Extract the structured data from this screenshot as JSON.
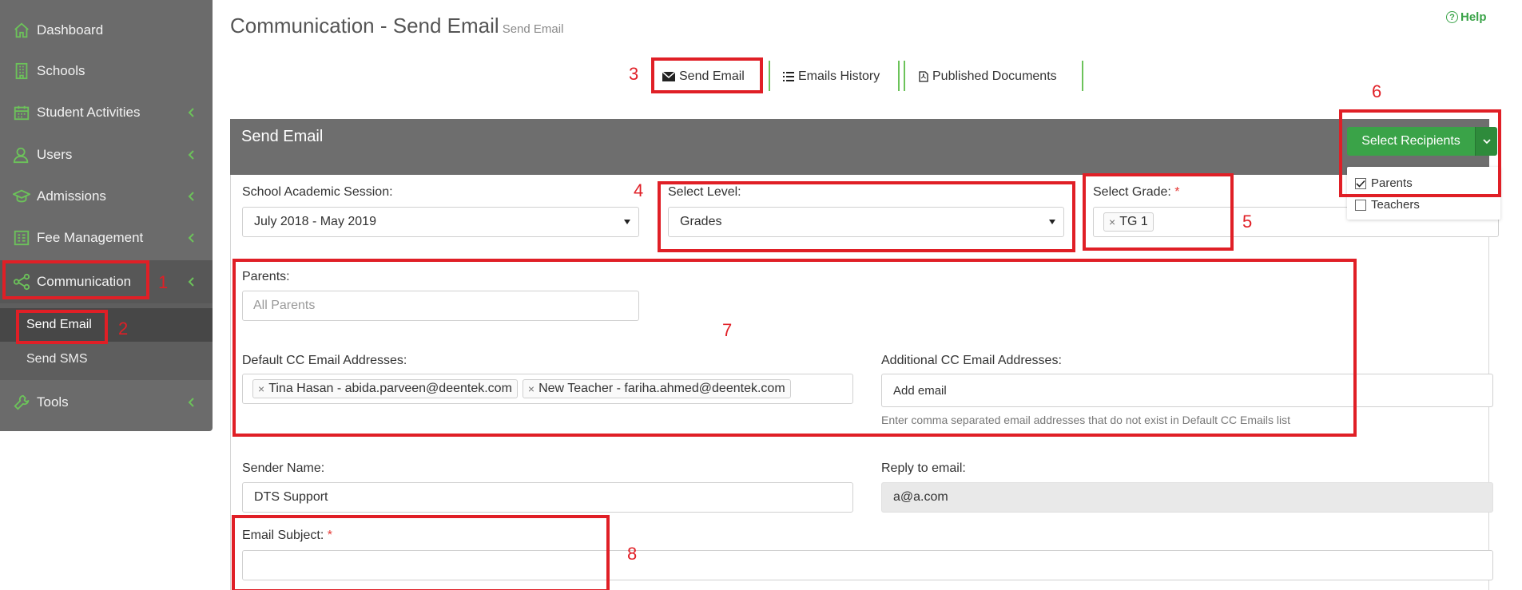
{
  "sidebar": {
    "items": [
      {
        "label": "Dashboard",
        "icon": "home-icon"
      },
      {
        "label": "Schools",
        "icon": "building-icon"
      },
      {
        "label": "Student Activities",
        "icon": "calendar-icon"
      },
      {
        "label": "Users",
        "icon": "user-icon"
      },
      {
        "label": "Admissions",
        "icon": "graduation-cap-icon"
      },
      {
        "label": "Fee Management",
        "icon": "fee-grid-icon"
      },
      {
        "label": "Communication",
        "icon": "share-icon"
      },
      {
        "label": "Tools",
        "icon": "wrench-icon"
      }
    ],
    "sub_items": [
      {
        "label": "Send Email"
      },
      {
        "label": "Send SMS"
      }
    ]
  },
  "header": {
    "title": "Communication - Send Email",
    "subtitle": "Send Email",
    "help_label": "Help"
  },
  "tabs": [
    {
      "label": "Send Email",
      "icon": "envelope-icon"
    },
    {
      "label": "Emails History",
      "icon": "list-icon"
    },
    {
      "label": "Published Documents",
      "icon": "file-pdf-icon"
    }
  ],
  "panel": {
    "title": "Send Email",
    "recipients_button": "Select Recipients",
    "recipients_options": [
      {
        "label": "Parents",
        "checked": true
      },
      {
        "label": "Teachers",
        "checked": false
      }
    ]
  },
  "form": {
    "session_label": "School Academic Session:",
    "session_value": "July 2018 - May 2019",
    "level_label": "Select Level:",
    "level_value": "Grades",
    "grade_label": "Select Grade:",
    "grade_required": "*",
    "grade_tags": [
      "TG 1"
    ],
    "parents_label": "Parents:",
    "parents_placeholder": "All Parents",
    "default_cc_label": "Default CC Email Addresses:",
    "default_cc_tags": [
      "Tina Hasan - abida.parveen@deentek.com",
      "New Teacher - fariha.ahmed@deentek.com"
    ],
    "additional_cc_label": "Additional CC Email Addresses:",
    "additional_cc_placeholder": "Add email",
    "additional_cc_hint": "Enter comma separated email addresses that do not exist in Default CC Emails list",
    "sender_label": "Sender Name:",
    "sender_value": "DTS Support",
    "reply_label": "Reply to email:",
    "reply_value": "a@a.com",
    "subject_label": "Email Subject:",
    "subject_required": "*",
    "subject_value": ""
  },
  "annotations": [
    "1",
    "2",
    "3",
    "4",
    "5",
    "6",
    "7",
    "8"
  ],
  "colors": {
    "sidebar_bg": "#6b6b6b",
    "panel_header_bg": "#6e6e6e",
    "accent_green": "#3aa348",
    "annotation_red": "#e01f26"
  }
}
